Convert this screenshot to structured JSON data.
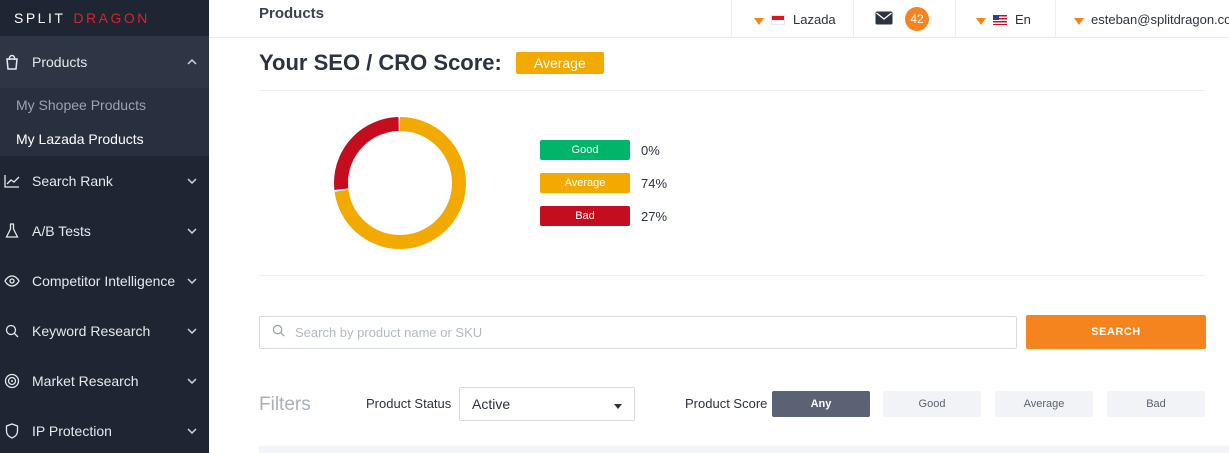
{
  "brand": {
    "part1": "SPLIT",
    "part2": "DRAGON"
  },
  "sidebar": {
    "items": [
      {
        "label": "Products",
        "icon": "shopping-bag-icon",
        "active": true,
        "subitems": [
          {
            "label": "My Shopee Products",
            "active": false
          },
          {
            "label": "My Lazada Products",
            "active": true
          }
        ]
      },
      {
        "label": "Search Rank",
        "icon": "trend-line-icon"
      },
      {
        "label": "A/B Tests",
        "icon": "flask-icon"
      },
      {
        "label": "Competitor Intelligence",
        "icon": "eye-icon"
      },
      {
        "label": "Keyword Research",
        "icon": "search-icon"
      },
      {
        "label": "Market Research",
        "icon": "target-icon"
      },
      {
        "label": "IP Protection",
        "icon": "shield-icon"
      }
    ]
  },
  "topbar": {
    "page_title": "Products",
    "marketplace": "Lazada",
    "mail_count": "42",
    "language": "En",
    "user_email": "esteban@splitdragon.com"
  },
  "score": {
    "title": "Your SEO / CRO Score:",
    "rating": "Average"
  },
  "chart_data": {
    "type": "pie",
    "categories": [
      "Good",
      "Average",
      "Bad"
    ],
    "values": [
      0,
      74,
      27
    ],
    "value_labels": [
      "0%",
      "74%",
      "27%"
    ],
    "colors": [
      "#00b56a",
      "#f2aa00",
      "#c40d1e"
    ],
    "donut": true
  },
  "search": {
    "placeholder": "Search by product name or SKU",
    "button_label": "SEARCH"
  },
  "filters": {
    "label": "Filters",
    "status_label": "Product Status",
    "status_value": "Active",
    "score_label": "Product Score",
    "score_options": [
      "Any",
      "Good",
      "Average",
      "Bad"
    ],
    "score_selected": "Any"
  },
  "colors": {
    "sidebar_bg": "#1e2533",
    "accent_orange": "#f5841f",
    "average": "#f2aa00",
    "good": "#00b56a",
    "bad": "#c40d1e"
  }
}
